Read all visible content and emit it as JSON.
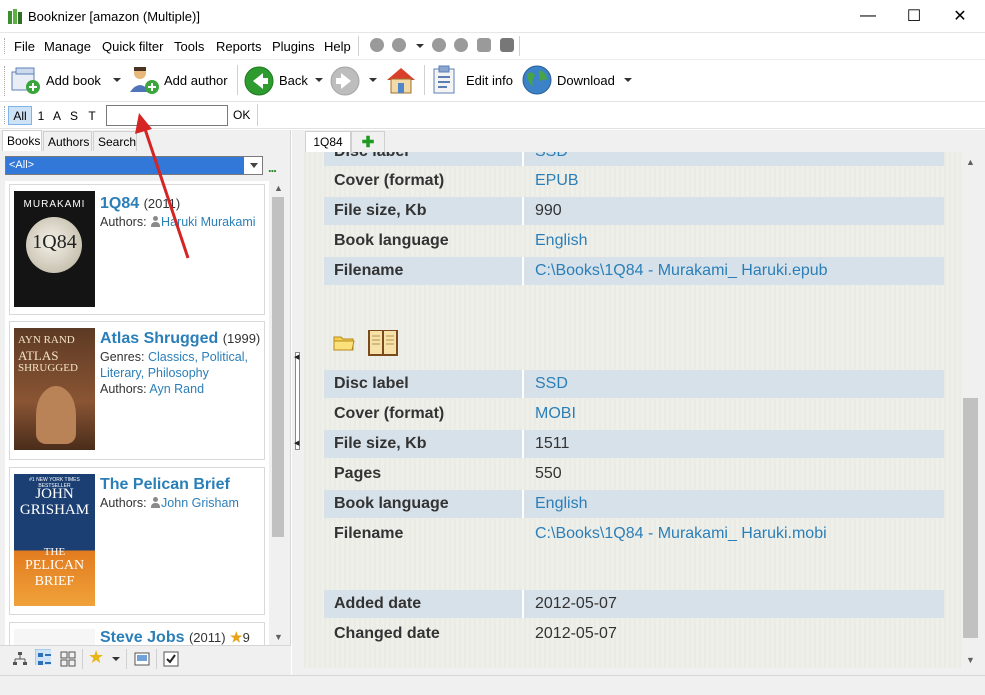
{
  "window": {
    "title": "Booknizer [amazon (Multiple)]",
    "minimize": "—",
    "maximize": "☐",
    "close": "✕"
  },
  "menu": [
    "File",
    "Manage",
    "Quick filter",
    "Tools",
    "Reports",
    "Plugins",
    "Help"
  ],
  "toolbar": {
    "add_book": "Add book",
    "add_author": "Add author",
    "back": "Back",
    "edit_info": "Edit info",
    "download": "Download"
  },
  "filter": {
    "all": "All",
    "letters": [
      "1",
      "A",
      "S",
      "T"
    ],
    "value": "",
    "ok": "OK"
  },
  "left_tabs": [
    "Books",
    "Authors",
    "Search"
  ],
  "category": {
    "selected": "<All>",
    "more": "..."
  },
  "books": [
    {
      "title": "1Q84",
      "year": "(2011)",
      "authors_label": "Authors:",
      "author": "Haruki Murakami",
      "cover_text": [
        "MURAKAMI",
        "1Q84"
      ]
    },
    {
      "title": "Atlas Shrugged",
      "year": "(1999)",
      "genres_label": "Genres:",
      "genres": "Classics, Political, Literary, Philosophy",
      "authors_label": "Authors:",
      "author": "Ayn Rand",
      "cover_text": [
        "AYN RAND",
        "ATLAS",
        "SHRUGGED"
      ]
    },
    {
      "title": "The Pelican Brief",
      "year": "",
      "authors_label": "Authors:",
      "author": "John Grisham",
      "cover_text": [
        "#1 NEW YORK TIMES BESTSELLER",
        "JOHN",
        "GRISHAM",
        "THE",
        "PELICAN",
        "BRIEF"
      ]
    },
    {
      "title": "Steve Jobs",
      "year": "(2011)",
      "rating": "9"
    }
  ],
  "detail_tab": "1Q84",
  "detail": {
    "partial_top_label": "Disc label",
    "partial_top_value": "SSD",
    "group1": [
      {
        "label": "Cover (format)",
        "value": "EPUB",
        "link": true
      },
      {
        "label": "File size, Kb",
        "value": "990",
        "link": false
      },
      {
        "label": "Book language",
        "value": "English",
        "link": true
      },
      {
        "label": "Filename",
        "value": "C:\\Books\\1Q84 - Murakami_ Haruki.epub",
        "link": true
      }
    ],
    "group2": [
      {
        "label": "Disc label",
        "value": "SSD",
        "link": true
      },
      {
        "label": "Cover (format)",
        "value": "MOBI",
        "link": true
      },
      {
        "label": "File size, Kb",
        "value": "1511",
        "link": false
      },
      {
        "label": "Pages",
        "value": "550",
        "link": false
      },
      {
        "label": "Book language",
        "value": "English",
        "link": true
      },
      {
        "label": "Filename",
        "value": "C:\\Books\\1Q84 - Murakami_ Haruki.mobi",
        "link": true
      }
    ],
    "dates": [
      {
        "label": "Added date",
        "value": "2012-05-07",
        "link": false
      },
      {
        "label": "Changed date",
        "value": "2012-05-07",
        "link": false
      }
    ]
  },
  "colors": {
    "link": "#2b7fb8",
    "row_alt": "#d7e1e9",
    "select": "#3278d8",
    "arrow": "#d42424"
  }
}
